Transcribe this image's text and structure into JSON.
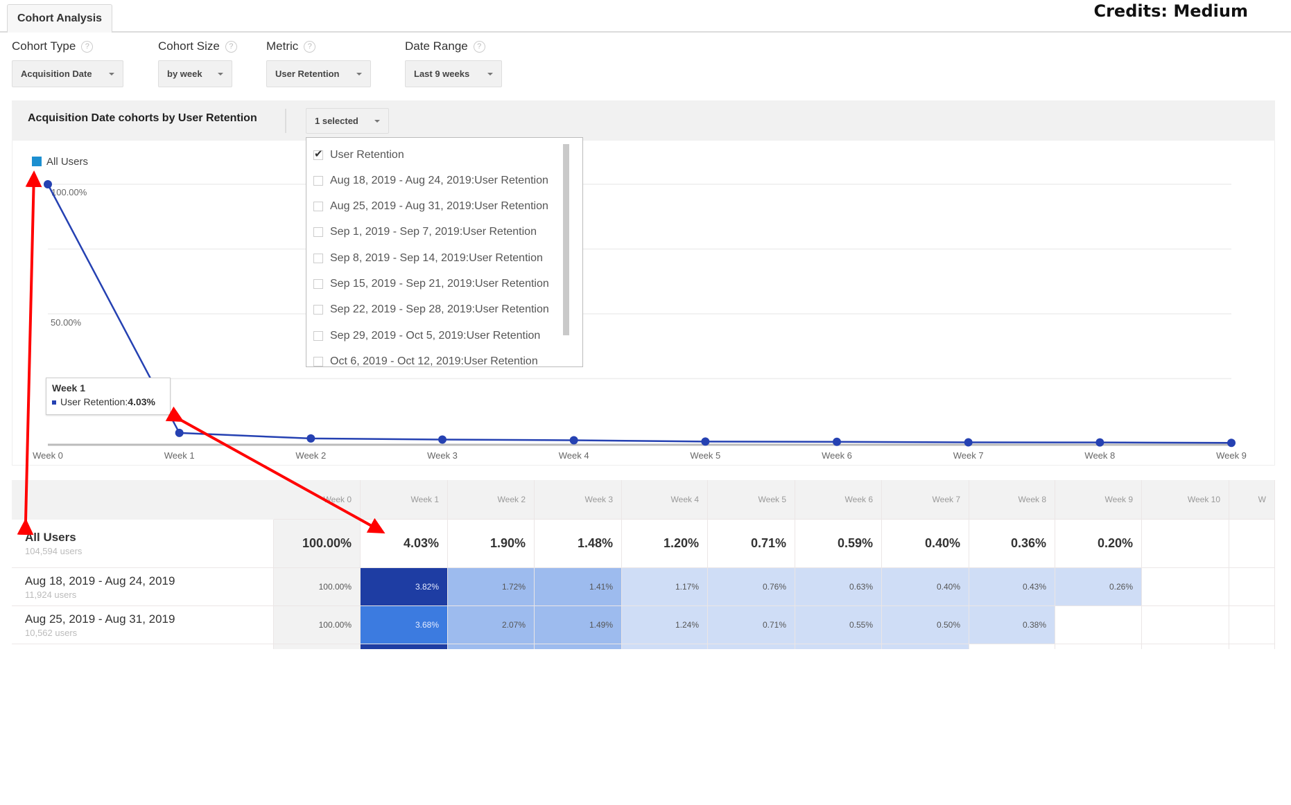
{
  "tab": {
    "label": "Cohort Analysis"
  },
  "credits": "Credits: Medium",
  "controls": [
    {
      "label": "Cohort Type",
      "value": "Acquisition Date"
    },
    {
      "label": "Cohort Size",
      "value": "by week"
    },
    {
      "label": "Metric",
      "value": "User Retention"
    },
    {
      "label": "Date Range",
      "value": "Last 9 weeks"
    }
  ],
  "help_glyph": "?",
  "panel": {
    "title": "Acquisition Date cohorts by User Retention",
    "selector_label": "1 selected"
  },
  "dropdown": {
    "items": [
      {
        "label": "User Retention",
        "checked": true
      },
      {
        "label": "Aug 18, 2019 - Aug 24, 2019:User Retention",
        "checked": false
      },
      {
        "label": "Aug 25, 2019 - Aug 31, 2019:User Retention",
        "checked": false
      },
      {
        "label": "Sep 1, 2019 - Sep 7, 2019:User Retention",
        "checked": false
      },
      {
        "label": "Sep 8, 2019 - Sep 14, 2019:User Retention",
        "checked": false
      },
      {
        "label": "Sep 15, 2019 - Sep 21, 2019:User Retention",
        "checked": false
      },
      {
        "label": "Sep 22, 2019 - Sep 28, 2019:User Retention",
        "checked": false
      },
      {
        "label": "Sep 29, 2019 - Oct 5, 2019:User Retention",
        "checked": false
      },
      {
        "label": "Oct 6, 2019 - Oct 12, 2019:User Retention",
        "checked": false
      }
    ]
  },
  "tooltip": {
    "title": "Week 1",
    "series": "User Retention:",
    "value": "4.03%"
  },
  "chart_data": {
    "type": "line",
    "title": "Acquisition Date cohorts by User Retention",
    "legend": [
      {
        "name": "All Users",
        "color": "#1c8fd0"
      }
    ],
    "legend_placement": "top-left",
    "categories": [
      "Week 0",
      "Week 1",
      "Week 2",
      "Week 3",
      "Week 4",
      "Week 5",
      "Week 6",
      "Week 7",
      "Week 8",
      "Week 9"
    ],
    "series": [
      {
        "name": "User Retention",
        "color": "#2541b2",
        "values": [
          100.0,
          4.03,
          1.9,
          1.48,
          1.2,
          0.71,
          0.59,
          0.4,
          0.36,
          0.2
        ]
      }
    ],
    "yticks": [
      {
        "value": 100,
        "label": "100.00%"
      },
      {
        "value": 50,
        "label": "50.00%"
      }
    ],
    "ylim": [
      0,
      100
    ],
    "grid": true,
    "xlabel": "",
    "ylabel": ""
  },
  "table": {
    "headers": [
      "Week 0",
      "Week 1",
      "Week 2",
      "Week 3",
      "Week 4",
      "Week 5",
      "Week 6",
      "Week 7",
      "Week 8",
      "Week 9",
      "Week 10",
      "W"
    ],
    "total": {
      "name": "All Users",
      "users": "104,594 users",
      "values": [
        "100.00%",
        "4.03%",
        "1.90%",
        "1.48%",
        "1.20%",
        "0.71%",
        "0.59%",
        "0.40%",
        "0.36%",
        "0.20%",
        "",
        ""
      ]
    },
    "rows": [
      {
        "name": "Aug 18, 2019 - Aug 24, 2019",
        "users": "11,924 users",
        "values": [
          "100.00%",
          "3.82%",
          "1.72%",
          "1.41%",
          "1.17%",
          "0.76%",
          "0.63%",
          "0.40%",
          "0.43%",
          "0.26%",
          "",
          ""
        ],
        "colors": [
          "#f2f2f2",
          "#1e3da3",
          "#9dbbee",
          "#9dbbee",
          "#cfddf6",
          "#cfddf6",
          "#cfddf6",
          "#cfddf6",
          "#cfddf6",
          "#cfddf6",
          "#ffffff",
          "#ffffff"
        ]
      },
      {
        "name": "Aug 25, 2019 - Aug 31, 2019",
        "users": "10,562 users",
        "values": [
          "100.00%",
          "3.68%",
          "2.07%",
          "1.49%",
          "1.24%",
          "0.71%",
          "0.55%",
          "0.50%",
          "0.38%",
          "",
          "",
          ""
        ],
        "colors": [
          "#f2f2f2",
          "#3c7be0",
          "#9dbbee",
          "#9dbbee",
          "#cfddf6",
          "#cfddf6",
          "#cfddf6",
          "#cfddf6",
          "#cfddf6",
          "#ffffff",
          "#ffffff",
          "#ffffff"
        ]
      },
      {
        "name": "",
        "users": "",
        "values": [
          "",
          "",
          "",
          "",
          "",
          "",
          "",
          "",
          "",
          "",
          "",
          ""
        ],
        "colors": [
          "#f2f2f2",
          "#1e3da3",
          "#9dbbee",
          "#9dbbee",
          "#cfddf6",
          "#cfddf6",
          "#cfddf6",
          "#cfddf6",
          "#ffffff",
          "#ffffff",
          "#ffffff",
          "#ffffff"
        ]
      }
    ]
  },
  "annotation_color": "#ff0000"
}
